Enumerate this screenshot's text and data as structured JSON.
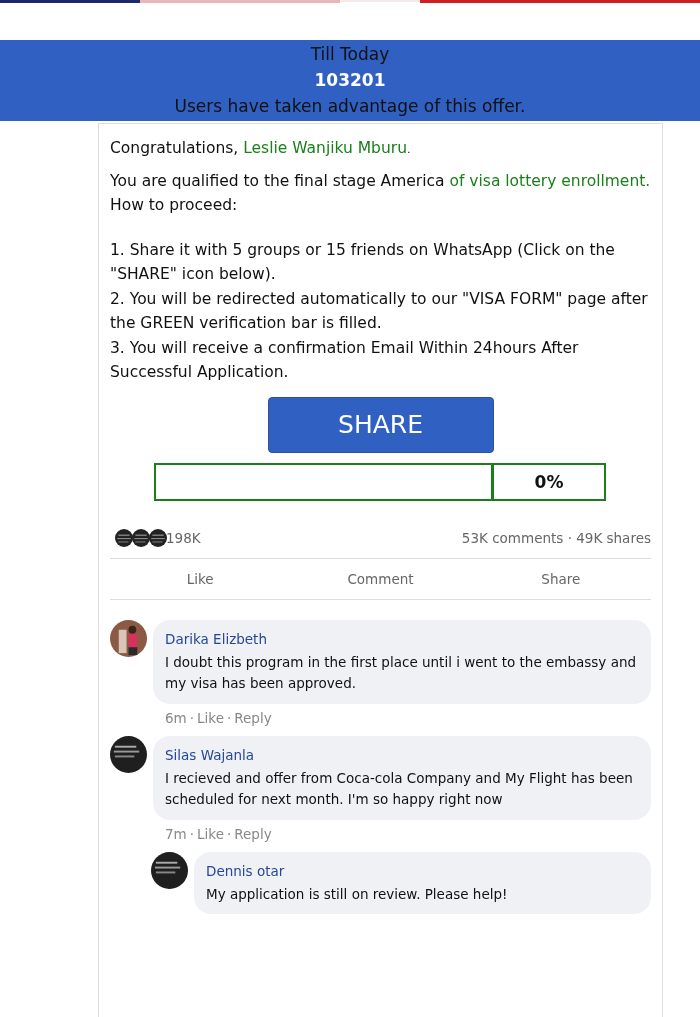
{
  "banner": {
    "line_1": "Till Today",
    "count": "103201",
    "line_2": "Users have taken advantage of this offer."
  },
  "message": {
    "greeting": "Congratulations, ",
    "name": "Leslie Wanjiku Mburu",
    "greeting_end": ".",
    "intro": [
      "You are qualified to the final stage America ",
      "of visa lottery enrollment.",
      " How to proceed:"
    ],
    "steps": [
      "1. Share it with 5 groups or 15 friends on WhatsApp (Click on the \"SHARE\" icon below).",
      "2. You will be redirected automatically to our \"VISA FORM\" page after the GREEN verification bar is filled.",
      "3. You will receive a confirmation Email Within 24hours After Successful Application."
    ]
  },
  "share_button": "SHARE",
  "verification": {
    "level": 0,
    "reading": "0%"
  },
  "stats": {
    "reactions": "198K",
    "comments_shares": "53K comments · 49K shares"
  },
  "actions": [
    "Like",
    "Comment",
    "Share"
  ],
  "comments": [
    {
      "author": "Darika Elizbeth",
      "text": "I doubt this program in the first place until i went to the embassy and my visa has been approved.",
      "time": "6m",
      "dot_1": "·",
      "like": "Like",
      "dot_2": "·",
      "reply": "Reply"
    },
    {
      "author": "Silas Wajanla",
      "text": "I recieved and offer from Coca-cola Company and My Flight has been scheduled for next month. I'm so happy right now",
      "time": "7m",
      "dot_1": "·",
      "like": "Like",
      "dot_2": "·",
      "reply": "Reply",
      "avatar": {
        "kind": "dark"
      },
      "children": [
        {
          "author": "Dennis otar",
          "text": "My application is still on review. Please help!",
          "avatar": {
            "kind": "dark"
          }
        }
      ]
    }
  ]
}
